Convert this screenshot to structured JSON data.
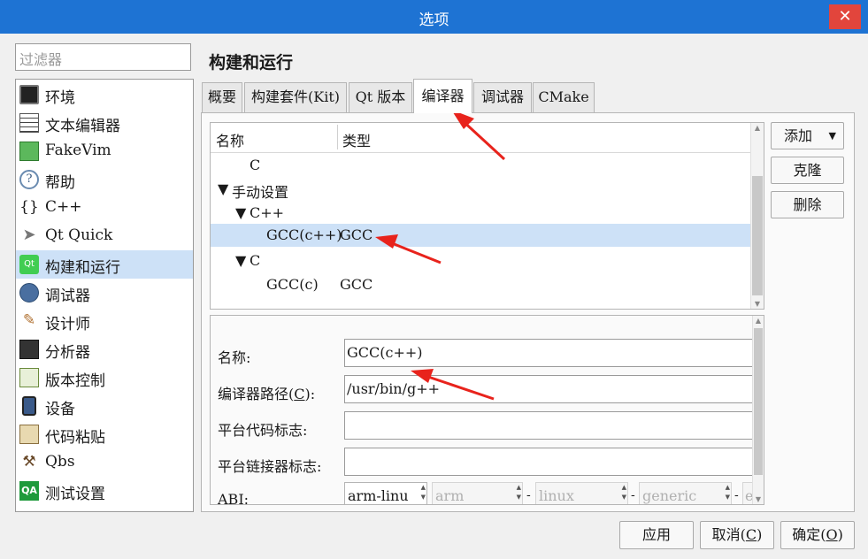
{
  "window": {
    "title": "选项",
    "close_glyph": "✕"
  },
  "filter": {
    "placeholder": "过滤器"
  },
  "sidebar": {
    "items": [
      {
        "label": "环境",
        "icon": "monitor-icon"
      },
      {
        "label": "文本编辑器",
        "icon": "text-editor-icon"
      },
      {
        "label": "FakeVim",
        "icon": "fakevim-icon"
      },
      {
        "label": "帮助",
        "icon": "help-icon"
      },
      {
        "label": "C++",
        "icon": "braces-icon"
      },
      {
        "label": "Qt Quick",
        "icon": "paper-plane-icon"
      },
      {
        "label": "构建和运行",
        "icon": "qt-build-icon",
        "selected": true
      },
      {
        "label": "调试器",
        "icon": "debugger-icon"
      },
      {
        "label": "设计师",
        "icon": "designer-icon"
      },
      {
        "label": "分析器",
        "icon": "analyzer-icon"
      },
      {
        "label": "版本控制",
        "icon": "version-control-icon"
      },
      {
        "label": "设备",
        "icon": "device-icon"
      },
      {
        "label": "代码粘贴",
        "icon": "code-paste-icon"
      },
      {
        "label": "Qbs",
        "icon": "hammer-icon"
      },
      {
        "label": "测试设置",
        "icon": "qa-icon"
      }
    ]
  },
  "page": {
    "title": "构建和运行"
  },
  "tabs": [
    {
      "label": "概要"
    },
    {
      "label": "构建套件(Kit)"
    },
    {
      "label": "Qt 版本"
    },
    {
      "label": "编译器",
      "active": true
    },
    {
      "label": "调试器"
    },
    {
      "label": "CMake"
    }
  ],
  "tree": {
    "headers": {
      "name": "名称",
      "type": "类型"
    },
    "rows": [
      {
        "name": "C",
        "type": ""
      },
      {
        "name": "手动设置",
        "type": ""
      },
      {
        "name": "C++",
        "type": ""
      },
      {
        "name": "GCC(c++)",
        "type": "GCC",
        "selected": true
      },
      {
        "name": "C",
        "type": ""
      },
      {
        "name": "GCC(c)",
        "type": "GCC"
      }
    ]
  },
  "side_buttons": {
    "add": "添加",
    "add_arrow": "▼",
    "clone": "克隆",
    "remove": "删除"
  },
  "details": {
    "name_label": "名称:",
    "name_value": "GCC(c++)",
    "path_label_prefix": "编译器路径(",
    "path_label_key": "C",
    "path_label_suffix": "):",
    "path_value": "/usr/bin/g++",
    "platform_code_label": "平台代码标志:",
    "platform_code_value": "",
    "platform_linker_label": "平台链接器标志:",
    "platform_linker_value": "",
    "abi_label": "ABI:",
    "abi_values": [
      "arm-linu",
      "arm",
      "linux",
      "generic",
      "e"
    ],
    "abi_separator": "-"
  },
  "footer": {
    "apply": "应用",
    "cancel_prefix": "取消(",
    "cancel_key": "C",
    "cancel_suffix": ")",
    "ok_prefix": "确定(",
    "ok_key": "O",
    "ok_suffix": ")"
  },
  "colors": {
    "titlebar": "#1e73d3",
    "close": "#e2453c",
    "selection": "#cde1f7",
    "annotation": "#e8231c"
  }
}
